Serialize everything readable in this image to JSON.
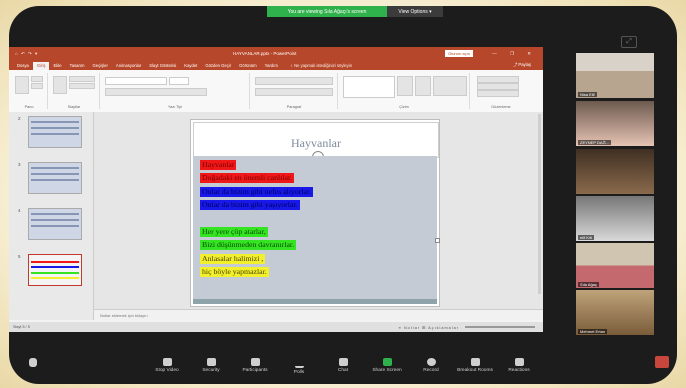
{
  "share_banner": {
    "text": "You are viewing Sıla Ağaçı's screen",
    "view_options": "View Options ▾"
  },
  "ppt": {
    "quick_access": "⌂ ↶ ↷ ▾",
    "doc_title": "HAYVANLAR.pptx - PowerPoint",
    "sign_in": "Oturum açın",
    "window_controls": "— ❐ ✕",
    "tabs": [
      "Dosya",
      "Giriş",
      "Ekle",
      "Tasarım",
      "Geçişler",
      "Animasyonlar",
      "Slayt Gösterisi",
      "Kaydet",
      "Gözden Geçir",
      "Görünüm",
      "Yardım"
    ],
    "active_tab": "Giriş",
    "tell_me": "♀ Ne yapmak istediğinizi söyleyin",
    "share": "⤴ Paylaş",
    "ribbon_groups": [
      "Pano",
      "Slaytlar",
      "Yazı Tipi",
      "Paragraf",
      "Çizim",
      "Düzenleme"
    ],
    "thumb_numbers": [
      "2",
      "3",
      "4",
      "5"
    ],
    "notes_placeholder": "Notlar eklemek için tıklayın",
    "status_left": "Slayt 5 / 5",
    "status_right": "≡ Notlar ⊞ Açıklamalar",
    "slide": {
      "title": "Hayvanlar",
      "lines": [
        {
          "text": "Hayvanlar",
          "style": "red"
        },
        {
          "text": "Doğadaki en önemli canlılar.",
          "style": "red"
        },
        {
          "text": "Onlar da bizim gibi nefes alıyorlar.",
          "style": "blue"
        },
        {
          "text": "Onlar da bizim gibi yaşıyorlar.",
          "style": "blue"
        },
        {
          "text": "Her yere çöp atarlar,",
          "style": "green"
        },
        {
          "text": "Bizi düşünmeden davranırlar.",
          "style": "green"
        },
        {
          "text": "Anlasalar halimizi ,",
          "style": "yellow"
        },
        {
          "text": "hiç böyle yapmazlar.",
          "style": "yellow"
        }
      ]
    }
  },
  "participants": [
    {
      "name": "Nisa Elif"
    },
    {
      "name": "ZEYNEP DAĞ..."
    },
    {
      "name": ""
    },
    {
      "name": "elif Kilt"
    },
    {
      "name": "Sıla Ağaç"
    },
    {
      "name": "Mehmet Ertan"
    }
  ],
  "toolbar": {
    "buttons": [
      {
        "label": "Stop Video",
        "icon": "video-icon"
      },
      {
        "label": "Security",
        "icon": "shield-icon"
      },
      {
        "label": "Participants",
        "icon": "participants-icon"
      },
      {
        "label": "Polls",
        "icon": "polls-icon"
      },
      {
        "label": "Chat",
        "icon": "chat-icon"
      },
      {
        "label": "Share Screen",
        "icon": "share-screen-icon"
      },
      {
        "label": "Record",
        "icon": "record-icon"
      },
      {
        "label": "Breakout Rooms",
        "icon": "breakout-rooms-icon"
      },
      {
        "label": "Reactions",
        "icon": "reactions-icon"
      }
    ]
  }
}
